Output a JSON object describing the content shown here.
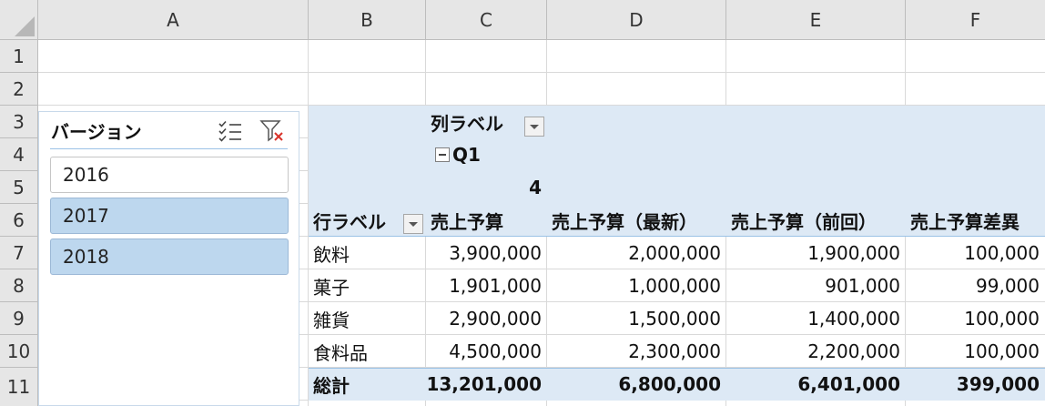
{
  "columns": [
    "A",
    "B",
    "C",
    "D",
    "E",
    "F"
  ],
  "rows": [
    "1",
    "2",
    "3",
    "4",
    "5",
    "6",
    "7",
    "8",
    "9",
    "10",
    "11"
  ],
  "slicer": {
    "title": "バージョン",
    "icons": [
      "multi-select-icon",
      "clear-filter-icon"
    ],
    "items": [
      {
        "label": "2016",
        "selected": false
      },
      {
        "label": "2017",
        "selected": true
      },
      {
        "label": "2018",
        "selected": true
      }
    ]
  },
  "pivot": {
    "col_label": "列ラベル",
    "q_label": "Q1",
    "q_number": "4",
    "row_label": "行ラベル",
    "headers": [
      "売上予算",
      "売上予算（最新）",
      "売上予算（前回）",
      "売上予算差異"
    ],
    "rows": [
      {
        "label": "飲料",
        "values": [
          "3,900,000",
          "2,000,000",
          "1,900,000",
          "100,000"
        ]
      },
      {
        "label": "菓子",
        "values": [
          "1,901,000",
          "1,000,000",
          "901,000",
          "99,000"
        ]
      },
      {
        "label": "雑貨",
        "values": [
          "2,900,000",
          "1,500,000",
          "1,400,000",
          "100,000"
        ]
      },
      {
        "label": "食料品",
        "values": [
          "4,500,000",
          "2,300,000",
          "2,200,000",
          "100,000"
        ]
      }
    ],
    "total": {
      "label": "総計",
      "values": [
        "13,201,000",
        "6,800,000",
        "6,401,000",
        "399,000"
      ]
    }
  },
  "colors": {
    "pivot_fill": "#dde9f5",
    "slicer_selected": "#bdd7ee",
    "header_fill": "#e6e6e6"
  }
}
